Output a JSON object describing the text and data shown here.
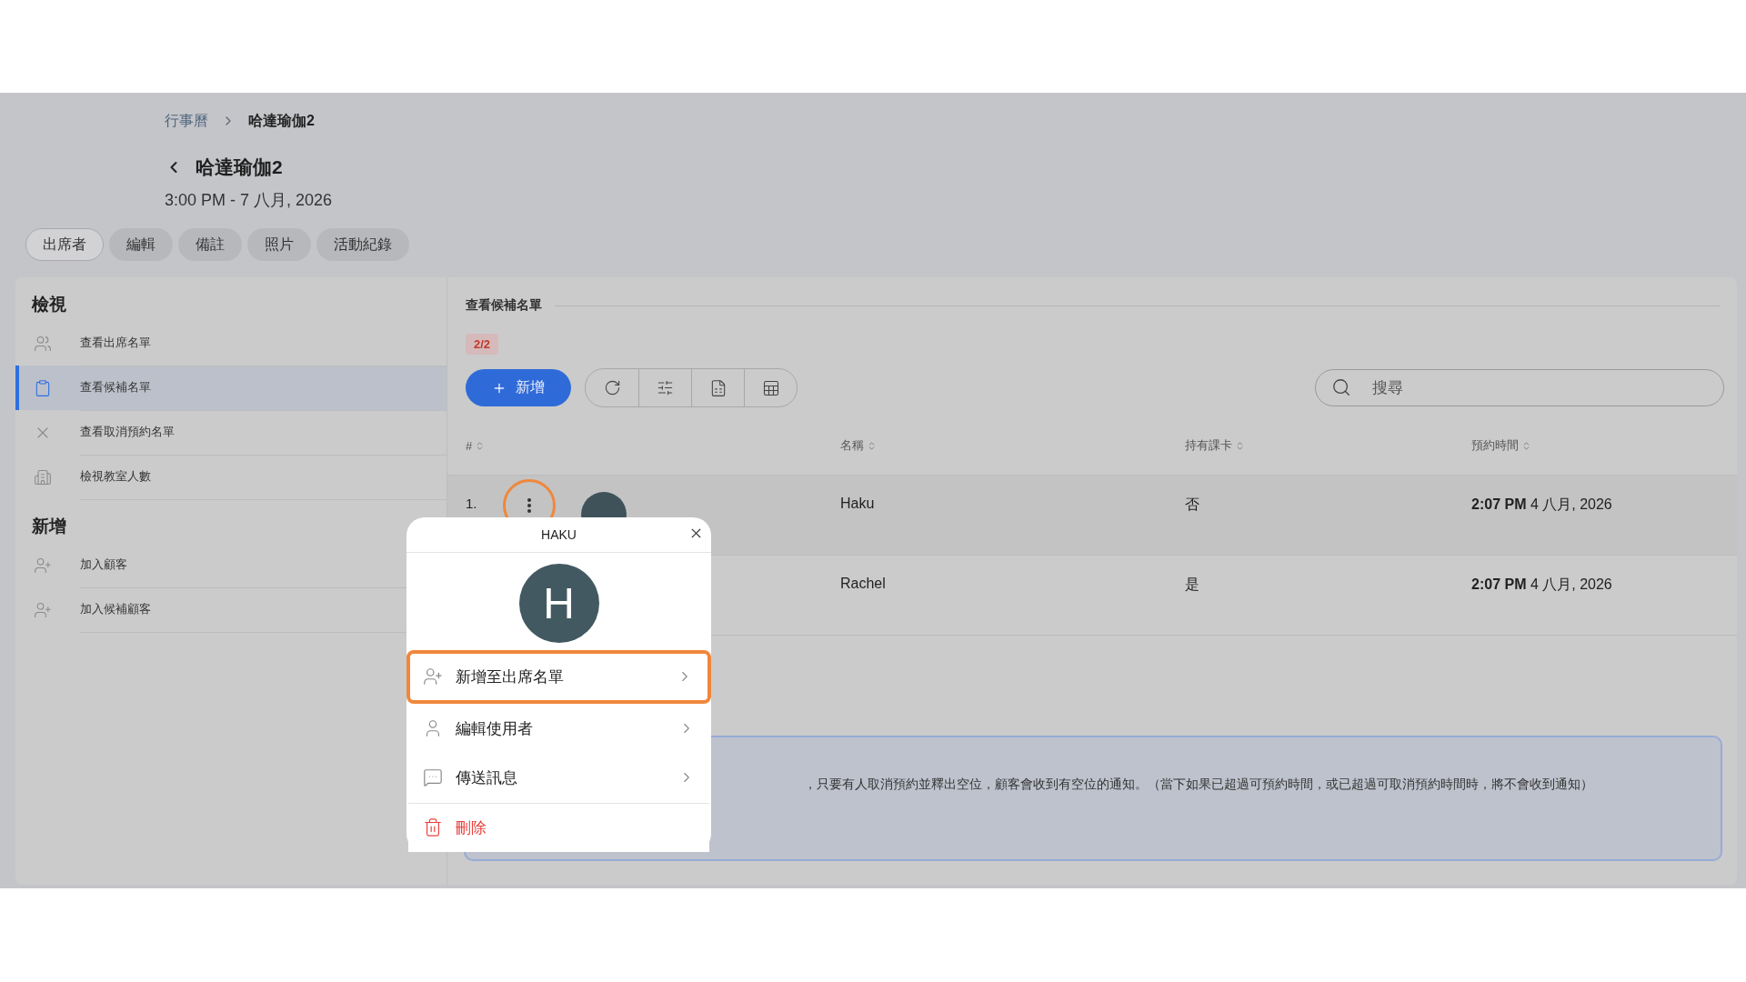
{
  "breadcrumb": [
    {
      "label": "行事曆"
    },
    {
      "label": "哈達瑜伽2"
    }
  ],
  "header": {
    "title": "哈達瑜伽2",
    "subtitle": "3:00 PM - 7 八月, 2026"
  },
  "tabs": [
    {
      "label": "出席者",
      "selected": true
    },
    {
      "label": "編輯",
      "selected": false
    },
    {
      "label": "備註",
      "selected": false
    },
    {
      "label": "照片",
      "selected": false
    },
    {
      "label": "活動紀錄",
      "selected": false
    }
  ],
  "sidebar": {
    "sections": [
      {
        "title": "檢視",
        "items": [
          {
            "label": "查看出席名單",
            "kind": "people",
            "selected": false
          },
          {
            "label": "查看候補名單",
            "kind": "clipboard",
            "selected": true
          },
          {
            "label": "查看取消預約名單",
            "kind": "cross",
            "selected": false
          },
          {
            "label": "檢視教室人數",
            "kind": "building",
            "selected": false
          }
        ]
      },
      {
        "title": "新增",
        "items": [
          {
            "label": "加入顧客",
            "kind": "addperson",
            "selected": false
          },
          {
            "label": "加入候補顧客",
            "kind": "addperson",
            "selected": false
          }
        ]
      }
    ]
  },
  "panel": {
    "title": "查看候補名單",
    "count_badge": "2/2",
    "add_button": "新增",
    "search": {
      "placeholder": "搜尋"
    }
  },
  "table": {
    "columns": [
      "#",
      "名稱",
      "持有課卡",
      "預約時間"
    ],
    "rows": [
      {
        "index": "1.",
        "name": "Haku",
        "has_card": "否",
        "time": "**2:07 PM** 4 八月, 2026",
        "selected": true
      },
      {
        "name": "Rachel",
        "has_card": "是",
        "time": "**2:07 PM** 4 八月, 2026",
        "selected": false
      }
    ]
  },
  "notice": "，只要有人取消預約並釋出空位，顧客會收到有空位的通知。（當下如果已超過可預約時間，或已超過可取消預約時間時，將不會收到通知）",
  "popup": {
    "title": "HAKU",
    "avatar": "H",
    "items": [
      {
        "label": "新增至出席名單",
        "kind": "add",
        "selected": true
      },
      {
        "label": "編輯使用者",
        "kind": "edit",
        "selected": false
      },
      {
        "label": "傳送訊息",
        "kind": "message",
        "selected": false
      },
      {
        "label": "刪除",
        "kind": "delete",
        "selected": false
      }
    ]
  }
}
